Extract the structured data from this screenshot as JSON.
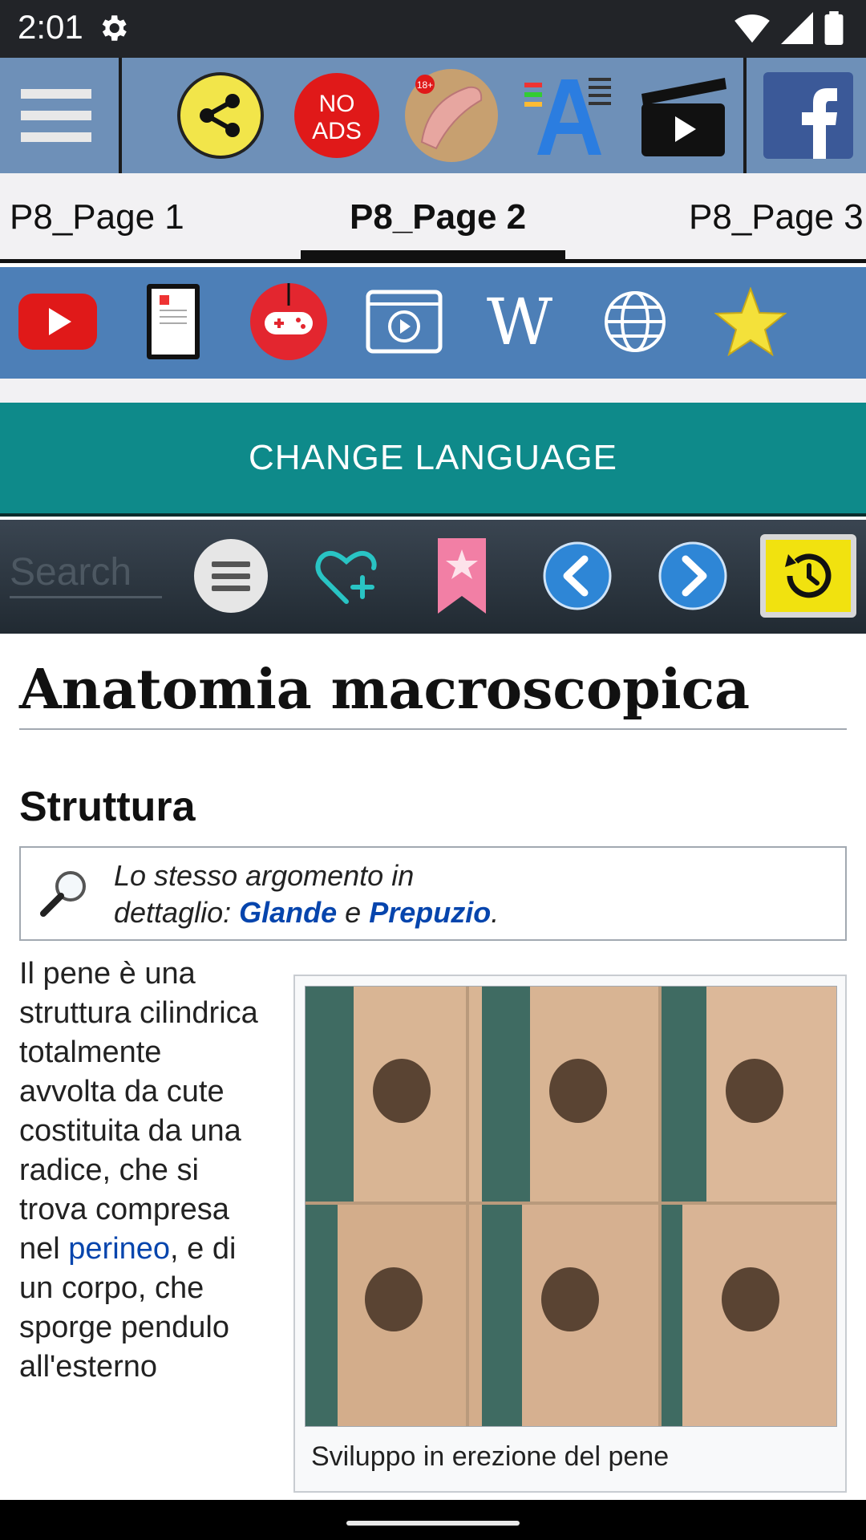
{
  "status_bar": {
    "time": "2:01",
    "icons": [
      "gear-icon",
      "wifi-icon",
      "signal-icon",
      "battery-icon"
    ]
  },
  "top_toolbar": {
    "items": [
      {
        "icon": "menu-icon"
      },
      {
        "icon": "share-icon",
        "color": "#f2e54a"
      },
      {
        "icon": "no-ads-icon",
        "label": "NO ADS",
        "color": "#e01919"
      },
      {
        "icon": "anatomy-icon"
      },
      {
        "icon": "font-size-icon"
      },
      {
        "icon": "video-icon"
      },
      {
        "icon": "facebook-icon",
        "color": "#3b5998"
      }
    ]
  },
  "tabs": [
    {
      "label": "P8_Page 1",
      "active": false
    },
    {
      "label": "P8_Page 2",
      "active": true
    },
    {
      "label": "P8_Page 3",
      "active": false
    }
  ],
  "toolbar2": {
    "items": [
      {
        "icon": "youtube-icon"
      },
      {
        "icon": "ebook-icon"
      },
      {
        "icon": "gamepad-icon"
      },
      {
        "icon": "video-player-icon"
      },
      {
        "icon": "wikipedia-icon",
        "label": "W"
      },
      {
        "icon": "globe-icon"
      },
      {
        "icon": "star-icon"
      }
    ]
  },
  "change_language": {
    "label": "CHANGE LANGUAGE"
  },
  "search_bar": {
    "placeholder": "Search",
    "icons": [
      "list-icon",
      "heart-add-icon",
      "bookmark-icon",
      "back-icon",
      "forward-icon",
      "history-icon"
    ]
  },
  "article": {
    "title": "Anatomia macroscopica",
    "section_title": "Struttura",
    "note": {
      "prefix": "Lo stesso argomento in dettaglio: ",
      "link1": "Glande",
      "conjunction": " e ",
      "link2": "Prepuzio",
      "suffix": "."
    },
    "body_before_link": "Il pene è una struttura cilindrica totalmente avvolta da cute costituita da una radice, che si trova compresa nel ",
    "body_link": "perineo",
    "body_after_link": ", e di un corpo, che sporge pendulo all'esterno",
    "figure_caption": "Sviluppo in erezione del pene"
  },
  "colors": {
    "top_toolbar_bg": "#6e90b8",
    "toolbar2_bg": "#4d7fb7",
    "change_language_bg": "#0e8a8a",
    "link": "#0645ad"
  }
}
